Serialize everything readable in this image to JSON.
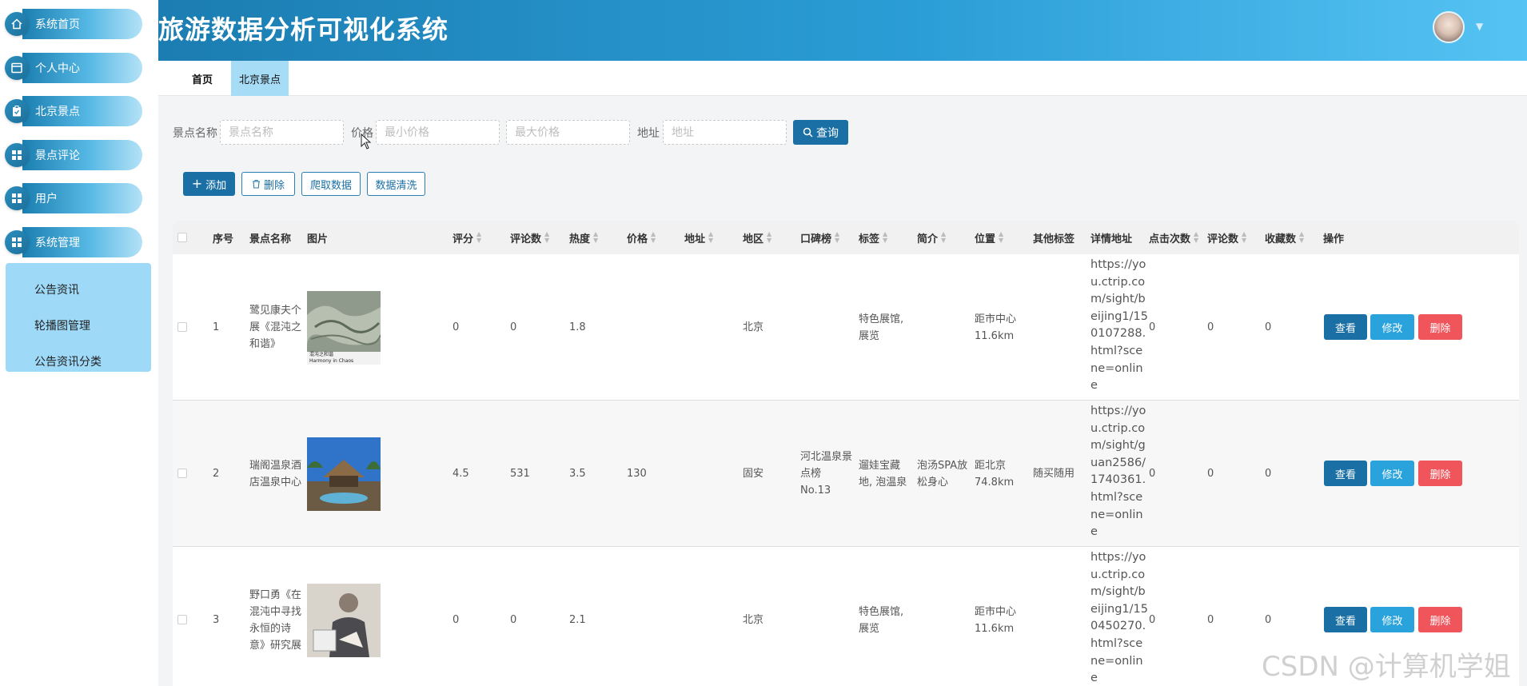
{
  "sidebar": {
    "items": [
      {
        "label": "系统首页",
        "icon": "home-icon"
      },
      {
        "label": "个人中心",
        "icon": "user-card-icon"
      },
      {
        "label": "北京景点",
        "icon": "clipboard-icon"
      },
      {
        "label": "景点评论",
        "icon": "grid-icon"
      },
      {
        "label": "用户",
        "icon": "grid-icon"
      },
      {
        "label": "系统管理",
        "icon": "grid-icon"
      }
    ],
    "submenu": [
      "公告资讯",
      "轮播图管理",
      "公告资讯分类"
    ]
  },
  "header": {
    "title": "旅游数据分析可视化系统",
    "avatar_caret": "▼"
  },
  "tabs": {
    "home": "首页",
    "active": "北京景点"
  },
  "search": {
    "name_label": "景点名称",
    "name_placeholder": "景点名称",
    "price_label": "价格",
    "min_placeholder": "最小价格",
    "max_placeholder": "最大价格",
    "address_label": "地址",
    "address_placeholder": "地址",
    "query_label": "查询"
  },
  "actions": {
    "add": "添加",
    "delete": "删除",
    "crawl": "爬取数据",
    "clean": "数据清洗"
  },
  "table": {
    "headers": [
      "序号",
      "景点名称",
      "图片",
      "评分",
      "评论数",
      "热度",
      "价格",
      "地址",
      "地区",
      "口碑榜",
      "标签",
      "简介",
      "位置",
      "其他标签",
      "详情地址",
      "点击次数",
      "评论数",
      "收藏数",
      "操作"
    ],
    "rows": [
      {
        "index": "1",
        "name": "鹭见康夫个展《混沌之和谐》",
        "rating": "0",
        "reviews": "0",
        "heat": "1.8",
        "price": "",
        "address": "",
        "region": "北京",
        "ranking": "",
        "tags": "特色展馆,展览",
        "intro": "",
        "location": "距市中心11.6km",
        "other_tags": "",
        "url": "https://you.ctrip.com/sight/beijing1/150107288.html?scene=online",
        "clicks": "0",
        "comments": "0",
        "favorites": "0"
      },
      {
        "index": "2",
        "name": "瑞阁温泉酒店温泉中心",
        "rating": "4.5",
        "reviews": "531",
        "heat": "3.5",
        "price": "130",
        "address": "",
        "region": "固安",
        "ranking": "河北温泉景点榜 No.13",
        "tags": "遛娃宝藏地, 泡温泉",
        "intro": "泡汤SPA放松身心",
        "location": "距北京74.8km",
        "other_tags": "随买随用",
        "url": "https://you.ctrip.com/sight/guan2586/1740361.html?scene=online",
        "clicks": "0",
        "comments": "0",
        "favorites": "0"
      },
      {
        "index": "3",
        "name": "野口勇《在混沌中寻找永恒的诗意》研究展",
        "rating": "0",
        "reviews": "0",
        "heat": "2.1",
        "price": "",
        "address": "",
        "region": "北京",
        "ranking": "",
        "tags": "特色展馆,展览",
        "intro": "",
        "location": "距市中心11.6km",
        "other_tags": "",
        "url": "https://you.ctrip.com/sight/beijing1/150450270.html?scene=online",
        "clicks": "0",
        "comments": "0",
        "favorites": "0"
      }
    ],
    "ops": {
      "view": "查看",
      "edit": "修改",
      "delete": "删除"
    },
    "thumb_captions": [
      "混沌之和谐",
      "Harmony in Chaos"
    ]
  },
  "watermark": "CSDN @计算机学姐",
  "colors": {
    "primary": "#1a6fa5",
    "header_start": "#1b7db1",
    "header_end": "#55c3f3",
    "delete": "#f0555c",
    "edit": "#2aa3dc"
  }
}
